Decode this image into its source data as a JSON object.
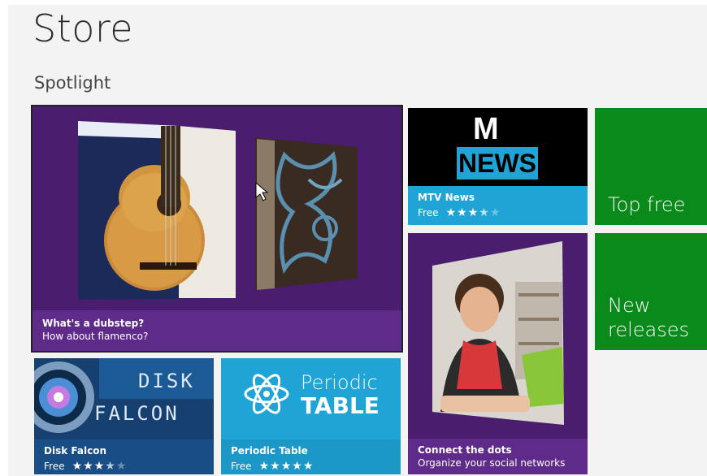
{
  "header": {
    "title": "Store",
    "section": "Spotlight"
  },
  "tiles": {
    "spotlight": {
      "title": "What's a dubstep?",
      "subtitle": "How about flamenco?",
      "bg": "#4b1d6e",
      "caption_bg": "#5f2b8a"
    },
    "mtv": {
      "logo_top": "M",
      "logo_text": "NEWS",
      "title": "MTV News",
      "price": "Free",
      "rating": 3.5,
      "stars": 5,
      "bg": "#000000",
      "caption_bg": "#1fa4d5"
    },
    "top_free": {
      "label": "Top free",
      "bg": "#0b8a1c"
    },
    "new_releases": {
      "label_line1": "New",
      "label_line2": "releases",
      "bg": "#0b8a1c"
    },
    "connect": {
      "title": "Connect the dots",
      "subtitle": "Organize your social networks",
      "bg": "#4b1d6e"
    },
    "disk_falcon": {
      "logo_line1": "DISK",
      "logo_line2": "FALCON",
      "title": "Disk Falcon",
      "price": "Free",
      "rating": 3.5,
      "stars": 5,
      "bg": "#123a6a",
      "caption_bg": "#184d86"
    },
    "periodic": {
      "logo_line1": "Periodic",
      "logo_line2": "TABLE",
      "title": "Periodic Table",
      "price": "Free",
      "rating": 5,
      "stars": 5,
      "bg": "#1fa4d5",
      "caption_bg": "#1b98c7"
    }
  }
}
